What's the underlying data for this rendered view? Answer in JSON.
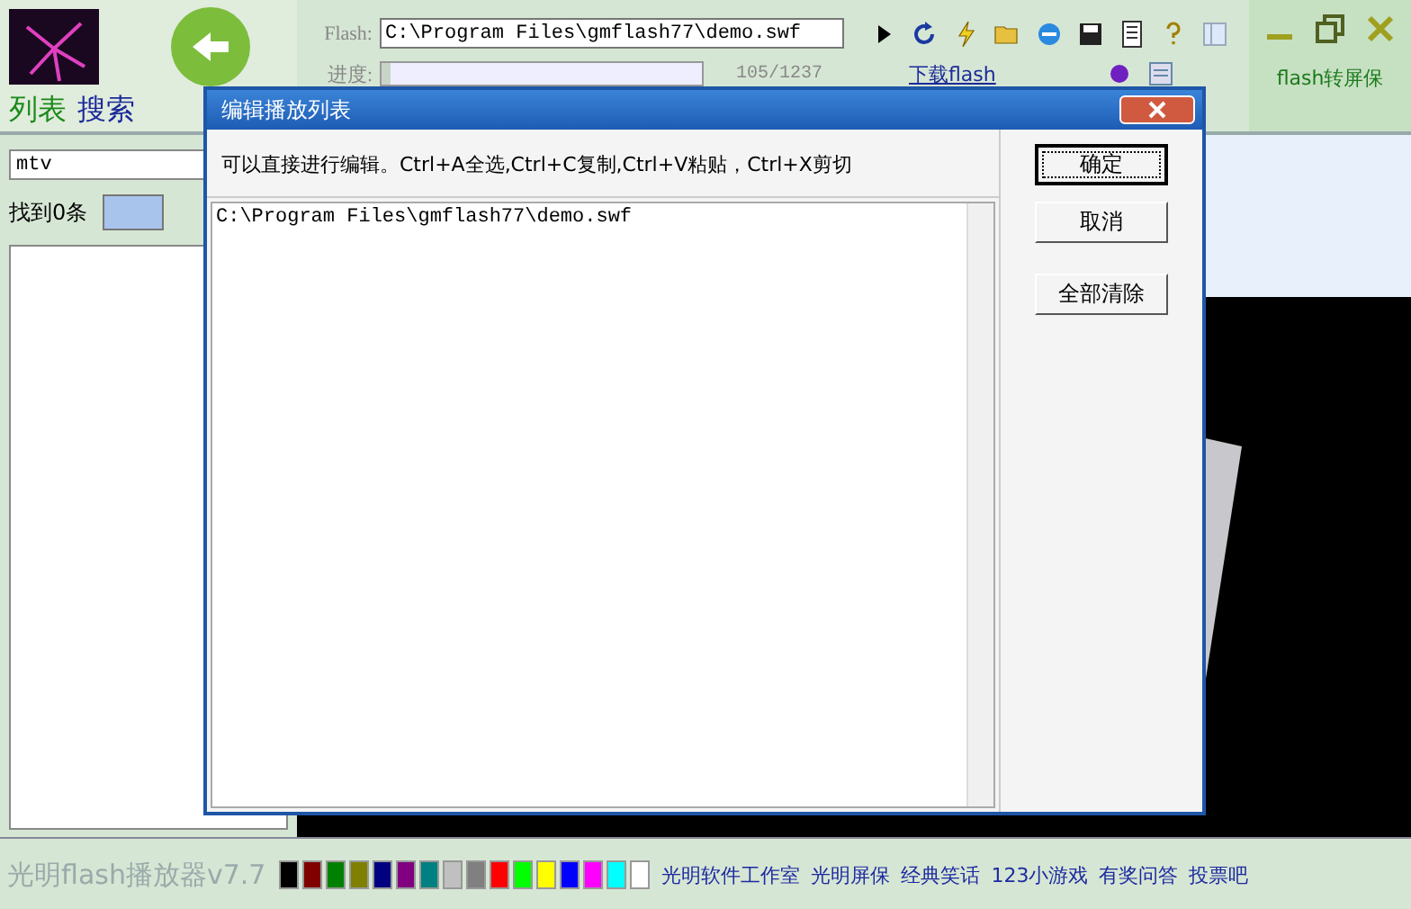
{
  "tabs": [
    {
      "label": "列表",
      "selected": true
    },
    {
      "label": "搜索",
      "selected": false
    }
  ],
  "flash_field": {
    "label": "Flash:",
    "value": "C:\\Program Files\\gmflash77\\demo.swf"
  },
  "progress": {
    "label": "进度:",
    "level": 0.03,
    "reading": "105/1237"
  },
  "download_link": "下载flash",
  "screensaver_link": "flash转屏保",
  "left_panel": {
    "category": "mtv",
    "found": "找到0条"
  },
  "dialog": {
    "title": "编辑播放列表",
    "instructions": "可以直接进行编辑。Ctrl+A全选,Ctrl+C复制,Ctrl+V粘贴，Ctrl+X剪切",
    "text": "C:\\Program Files\\gmflash77\\demo.swf",
    "buttons": [
      {
        "label": "确定",
        "default": true
      },
      {
        "label": "取消",
        "default": false
      },
      {
        "label": "全部清除",
        "default": false
      }
    ]
  },
  "status_bar": {
    "app_name": "光明flash播放器v7.7",
    "swatches": [
      {
        "color": "#000000"
      },
      {
        "color": "#800000"
      },
      {
        "color": "#008000"
      },
      {
        "color": "#808000"
      },
      {
        "color": "#000080"
      },
      {
        "color": "#800080"
      },
      {
        "color": "#008080"
      },
      {
        "color": "#c0c0c0"
      },
      {
        "color": "#808080"
      },
      {
        "color": "#ff0000"
      },
      {
        "color": "#00ff00"
      },
      {
        "color": "#ffff00"
      },
      {
        "color": "#0000ff"
      },
      {
        "color": "#ff00ff"
      },
      {
        "color": "#00ffff"
      },
      {
        "color": "#ffffff"
      }
    ],
    "links": [
      "光明软件工作室",
      "光明屏保",
      "经典笑话",
      "123小游戏",
      "有奖问答",
      "投票吧"
    ]
  }
}
